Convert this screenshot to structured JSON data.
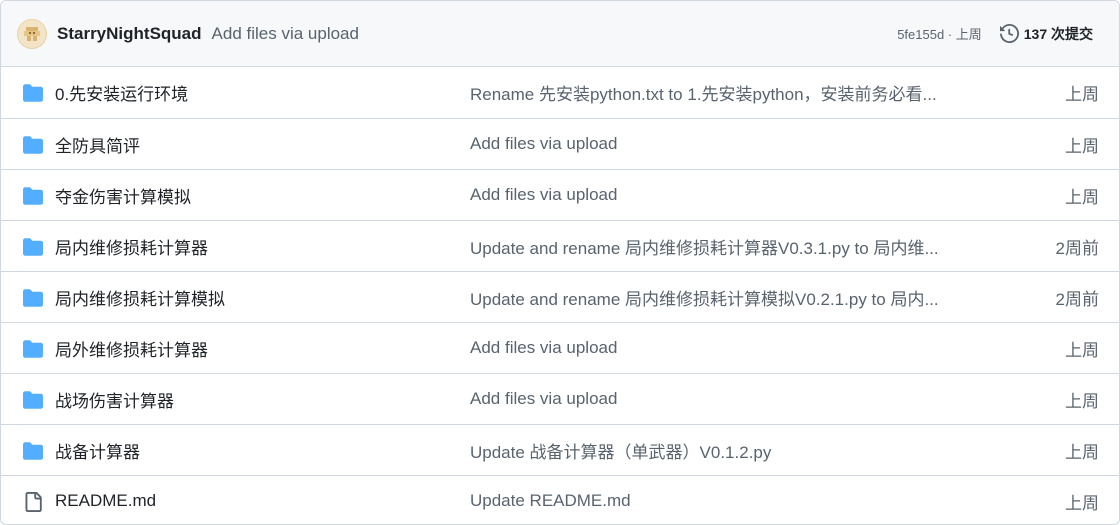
{
  "latest_commit": {
    "author": "StarryNightSquad",
    "message": "Add files via upload",
    "hash_time": "5fe155d · 上周",
    "commits_label": "137 次提交"
  },
  "colors": {
    "folder": "#54aeff",
    "text": "#1f2328",
    "muted": "#59636e",
    "border": "#d0d7de",
    "header_bg": "#f6f8fa"
  },
  "files": [
    {
      "icon": "folder-icon",
      "name": "0.先安装运行环境",
      "commit": "Rename 先安装python.txt to 1.先安装python，安装前务必看...",
      "time": "上周"
    },
    {
      "icon": "folder-icon",
      "name": "全防具简评",
      "commit": "Add files via upload",
      "time": "上周"
    },
    {
      "icon": "folder-icon",
      "name": "夺金伤害计算模拟",
      "commit": "Add files via upload",
      "time": "上周"
    },
    {
      "icon": "folder-icon",
      "name": "局内维修损耗计算器",
      "commit": "Update and rename 局内维修损耗计算器V0.3.1.py to 局内维...",
      "time": "2周前"
    },
    {
      "icon": "folder-icon",
      "name": "局内维修损耗计算模拟",
      "commit": "Update and rename 局内维修损耗计算模拟V0.2.1.py to 局内...",
      "time": "2周前"
    },
    {
      "icon": "folder-icon",
      "name": "局外维修损耗计算器",
      "commit": "Add files via upload",
      "time": "上周"
    },
    {
      "icon": "folder-icon",
      "name": "战场伤害计算器",
      "commit": "Add files via upload",
      "time": "上周"
    },
    {
      "icon": "folder-icon",
      "name": "战备计算器",
      "commit": "Update 战备计算器（单武器）V0.1.2.py",
      "time": "上周"
    },
    {
      "icon": "file-icon",
      "name": "README.md",
      "commit": "Update README.md",
      "time": "上周"
    }
  ]
}
